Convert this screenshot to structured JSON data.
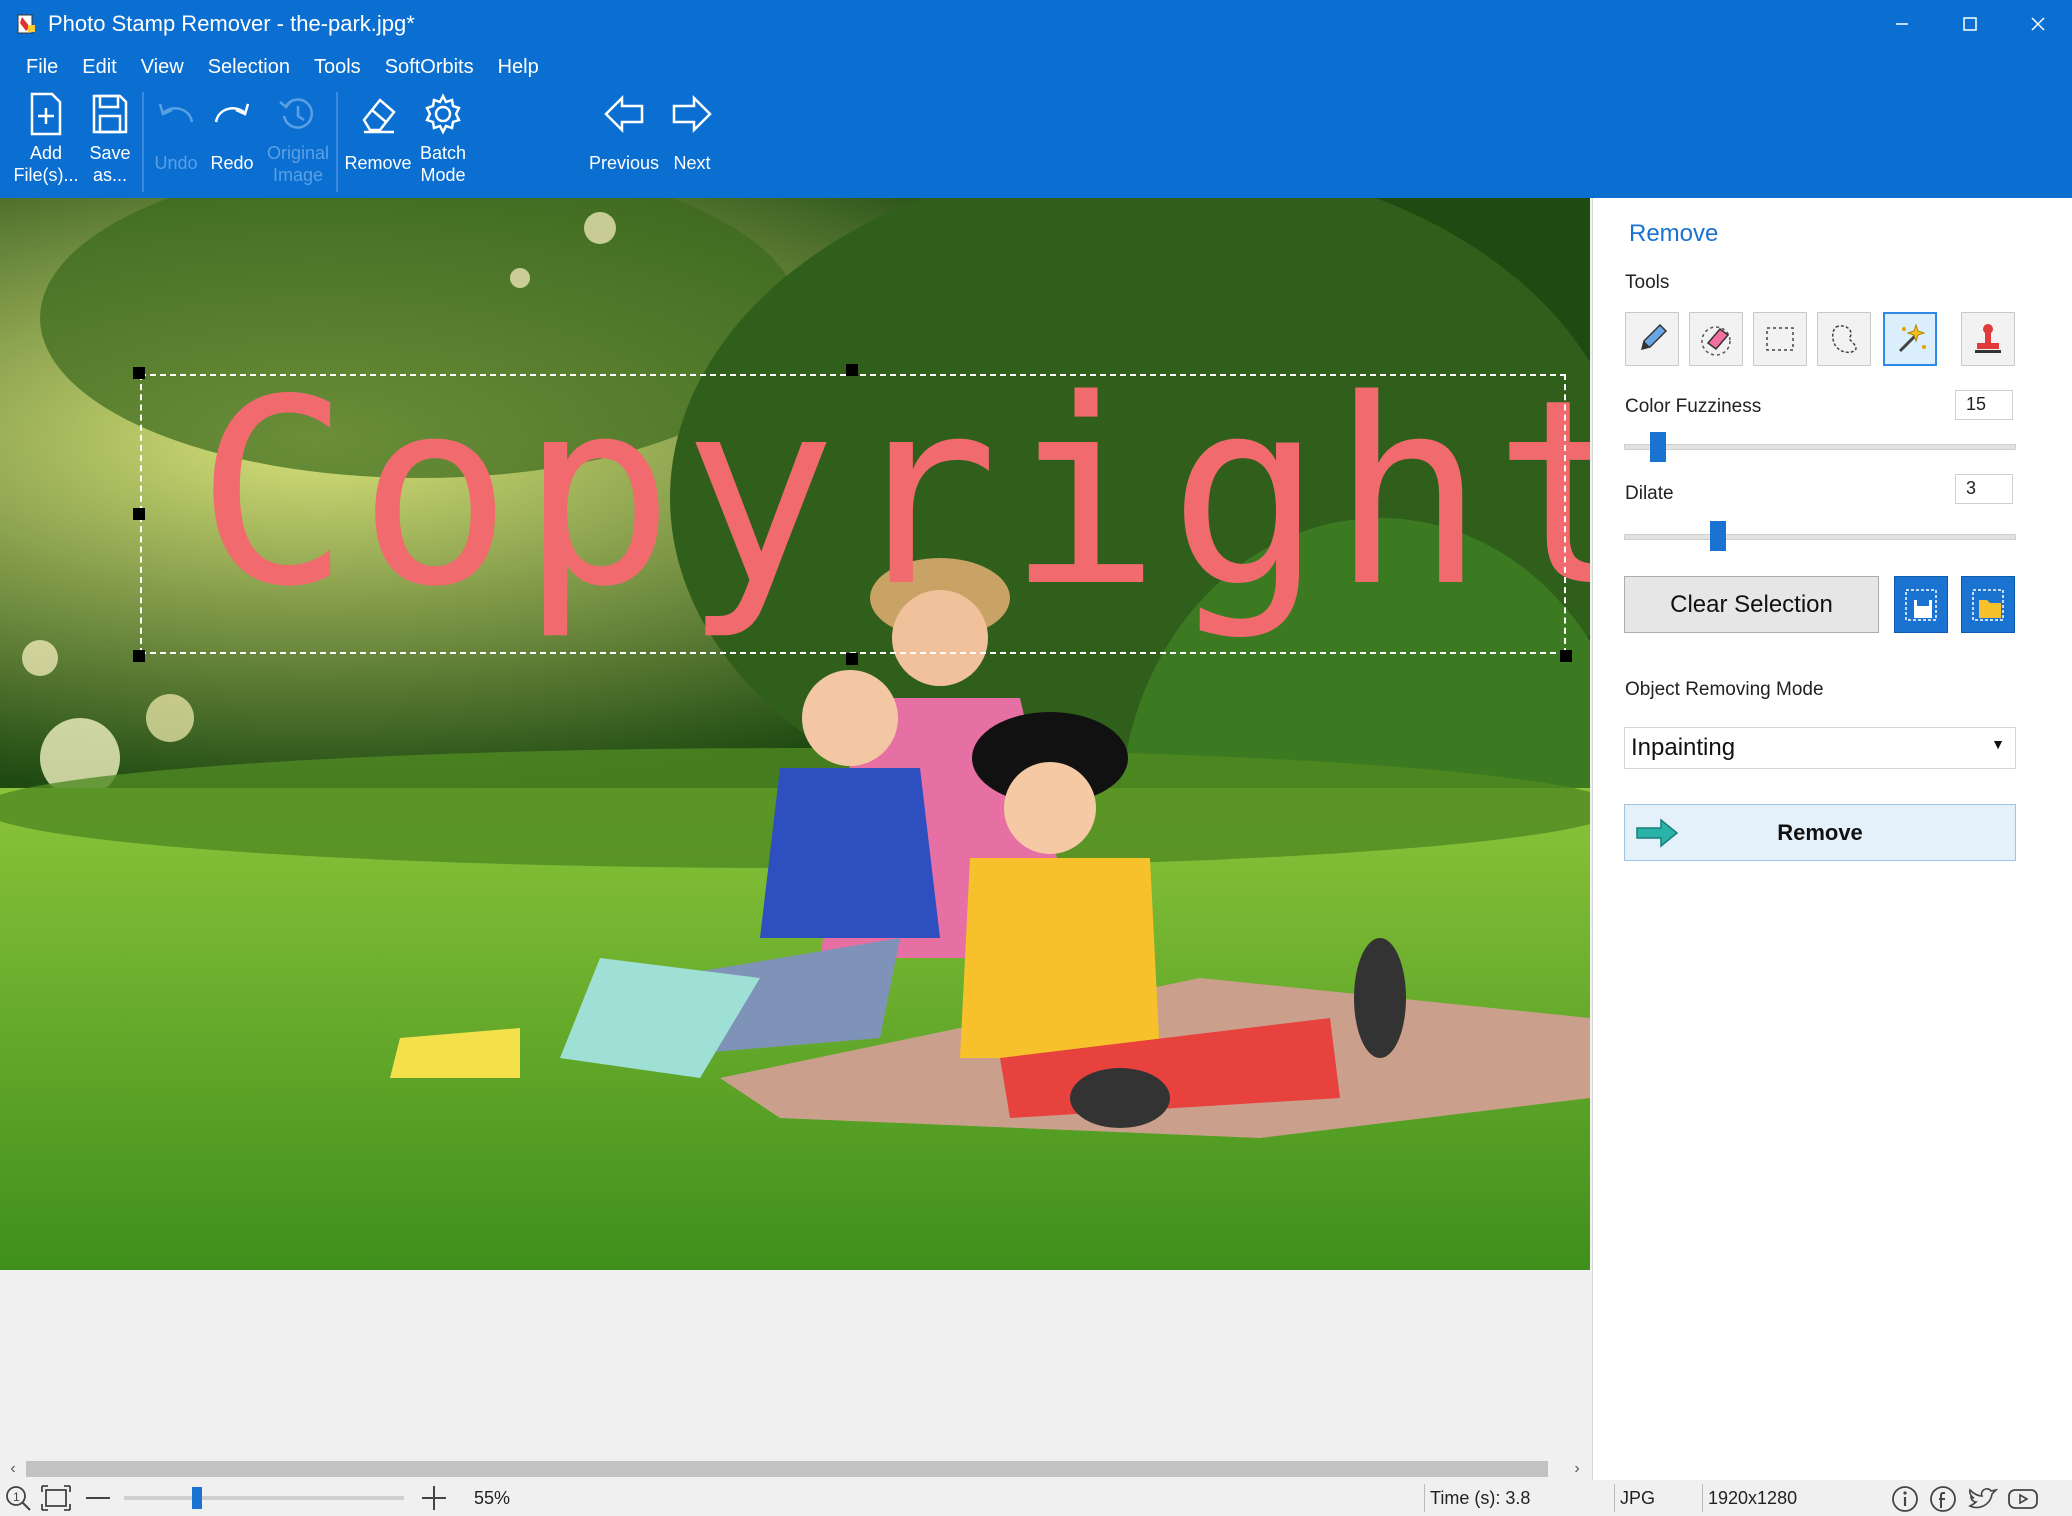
{
  "window": {
    "title": "Photo Stamp Remover - the-park.jpg*"
  },
  "menu": [
    "File",
    "Edit",
    "View",
    "Selection",
    "Tools",
    "SoftOrbits",
    "Help"
  ],
  "toolbar": {
    "add_files": [
      "Add",
      "File(s)..."
    ],
    "save_as": [
      "Save",
      "as..."
    ],
    "undo": "Undo",
    "redo": "Redo",
    "original_image": [
      "Original",
      "Image"
    ],
    "remove": "Remove",
    "batch_mode": [
      "Batch",
      "Mode"
    ],
    "previous": "Previous",
    "next": "Next"
  },
  "canvas": {
    "watermark_text": "Copyright"
  },
  "panel": {
    "title": "Remove",
    "tools_label": "Tools",
    "tools": [
      "pencil-icon",
      "eraser-icon",
      "rect-select-icon",
      "lasso-icon",
      "magic-wand-icon",
      "stamp-icon"
    ],
    "active_tool": "magic-wand-icon",
    "color_fuzziness_label": "Color Fuzziness",
    "color_fuzziness_value": "15",
    "color_fuzziness_level": 0.07,
    "dilate_label": "Dilate",
    "dilate_value": "3",
    "dilate_level": 0.23,
    "clear_selection": "Clear Selection",
    "mode_label": "Object Removing Mode",
    "mode_value": "Inpainting",
    "remove_button": "Remove"
  },
  "statusbar": {
    "zoom": "55%",
    "time": "Time (s): 3.8",
    "format": "JPG",
    "dimensions": "1920x1280"
  },
  "colors": {
    "chrome_blue": "#0b6fd1",
    "accent": "#1a73d1",
    "watermark": "#f06a6e"
  }
}
